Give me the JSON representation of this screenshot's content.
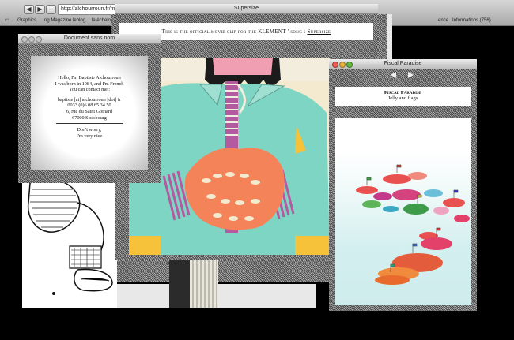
{
  "browser": {
    "url": "http://alchourroun.fr/ma",
    "tab_title": "Supersize",
    "bookmarks": [
      "Graphics",
      "ng Magazine",
      "leblog",
      "la échelons",
      "ence",
      "Informations (756)"
    ],
    "back_glyph": "◀",
    "forward_glyph": "▶",
    "add_glyph": "+"
  },
  "windows": {
    "supersize": {
      "title": "Supersize",
      "caption_text": "This is the official movie clip for the KLEMENT ' song : ",
      "caption_link": "Supersize"
    },
    "document": {
      "title": "Document sans nom",
      "lines": [
        "Hello, I'm Baptiste Alchourroun",
        "I was born in 1984, and I'm French",
        "You can contact me :",
        "",
        "baptiste [at] alchourroun [dot] fr",
        "0033 (0)6 08 65 34 50",
        "6, rue du Saint Gothard",
        "67000 Strasbourg",
        "",
        "Don't worry,",
        "I'm very nice"
      ]
    },
    "fiscal": {
      "title": "Fiscal Paradise",
      "heading": "Fiscal Paradise",
      "subheading": "Jelly and flags"
    }
  },
  "colors": {
    "video_cyan": "#7fd5c4",
    "video_orange": "#f4835a",
    "video_pink": "#f09fb2",
    "video_stripe": "#b45aa0",
    "light_red": "#e95c52",
    "light_yellow": "#e7b33a",
    "light_green": "#5fba3e"
  }
}
